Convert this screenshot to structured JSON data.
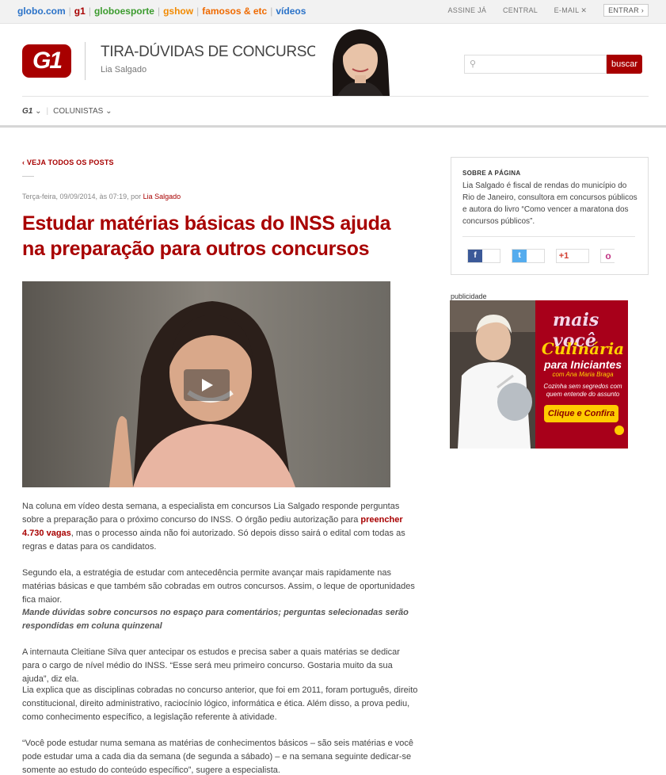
{
  "topbar": {
    "brands": [
      {
        "label": "globo.com",
        "color": "#2a72c8"
      },
      {
        "label": "g1",
        "color": "#a80000"
      },
      {
        "label": "globoesporte",
        "color": "#3b9b2e"
      },
      {
        "label": "gshow",
        "color": "#f28a00"
      },
      {
        "label": "famosos & etc",
        "color": "#ef6a00"
      },
      {
        "label": "vídeos",
        "color": "#2a72c8"
      }
    ],
    "links": {
      "assine": "ASSINE JÁ",
      "central": "CENTRAL",
      "email": "E-MAIL",
      "entrar": "ENTRAR"
    }
  },
  "header": {
    "logo": "G1",
    "title": "TIRA-DÚVIDAS DE CONCURSOS",
    "author": "Lia Salgado",
    "search": {
      "placeholder": "",
      "button": "buscar"
    }
  },
  "subnav": {
    "g1": "G1",
    "colunistas": "COLUNISTAS"
  },
  "article": {
    "back_link": "VEJA TODOS OS POSTS",
    "meta_date": "Terça-feira, 09/09/2014, às 07:19, por ",
    "meta_author": "Lia Salgado",
    "headline": "Estudar matérias básicas do INSS ajuda na preparação para outros concursos",
    "p1_before": "Na coluna em vídeo desta semana, a especialista em concursos Lia Salgado responde perguntas sobre a preparação para o próximo concurso do INSS. O órgão pediu autorização para ",
    "p1_link": "preencher 4.730 vagas",
    "p1_after": ", mas o processo ainda não foi autorizado. Só depois disso sairá o edital com todas as regras e datas para os candidatos.",
    "p2": "Segundo ela, a estratégia de estudar com antecedência permite avançar mais rapidamente nas matérias básicas e que também são cobradas em outros concursos. Assim, o leque de oportunidades fica maior.",
    "p3": "Mande dúvidas sobre concursos no espaço para comentários; perguntas selecionadas serão respondidas em coluna quinzenal",
    "p4": "A internauta Cleitiane Silva quer antecipar os estudos e precisa saber a quais matérias se dedicar para o cargo de nível médio do INSS. “Esse será meu primeiro concurso. Gostaria muito da sua ajuda”, diz ela.",
    "p5": "Lia explica que as disciplinas cobradas no concurso anterior, que foi em 2011, foram português, direito constitucional, direito administrativo, raciocínio lógico, informática e ética. Além disso, a prova pediu, como conhecimento específico, a legislação referente à atividade.",
    "p6": "“Você pode estudar numa semana as matérias de conhecimentos básicos – são seis matérias e você pode estudar uma a cada dia da semana (de segunda a sábado) – e na semana seguinte dedicar-se somente ao estudo do conteúdo específico”, sugere a especialista."
  },
  "sidebar": {
    "about_label": "SOBRE A PÁGINA",
    "about_text": "Lia Salgado é fiscal de rendas do município do Rio de Janeiro, consultora em concursos públicos e autora do livro “Como vencer a maratona dos concursos públicos”.",
    "share": {
      "facebook": "f",
      "twitter": "t",
      "gplus": "+1",
      "other": "o"
    },
    "publicidade": "publicidade",
    "ad": {
      "brand": "mais você",
      "title": "Culinária",
      "subtitle": "para Iniciantes",
      "com": "com Ana Maria Braga",
      "tagline": "Cozinha sem segredos com quem entende do assunto",
      "cta": "Clique e Confira"
    }
  }
}
